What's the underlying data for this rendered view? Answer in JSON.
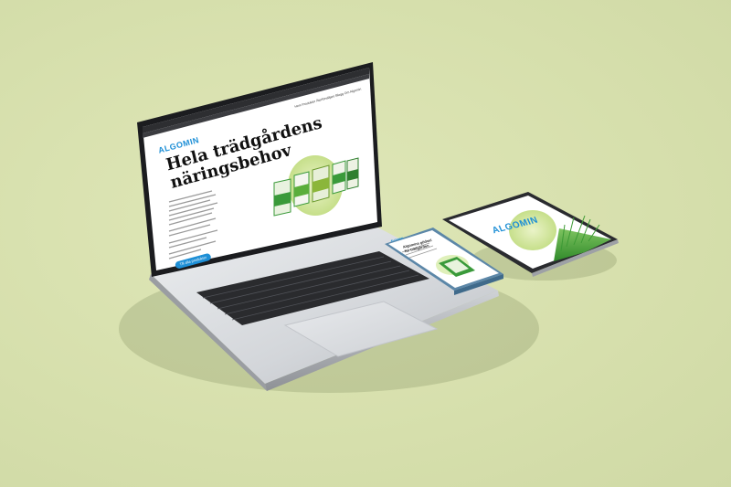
{
  "laptop": {
    "site_logo": "ALGOMIN",
    "headline_line1": "Hela trädgårdens",
    "headline_line2": "näringsbehov",
    "cta_label": "Till alla produkter",
    "nav": "Hem  Produkter  Återförsäljare  Blogg  Om Algomin"
  },
  "phone": {
    "logo": "ALGOMIN",
    "heading": "Algomins gödsel\nför trädgården"
  },
  "tablet": {
    "logo": "ALGOMIN"
  },
  "colors": {
    "background": "#d9e2b0",
    "brand_blue": "#1e8fd6",
    "product_green": "#3a9a3a"
  }
}
